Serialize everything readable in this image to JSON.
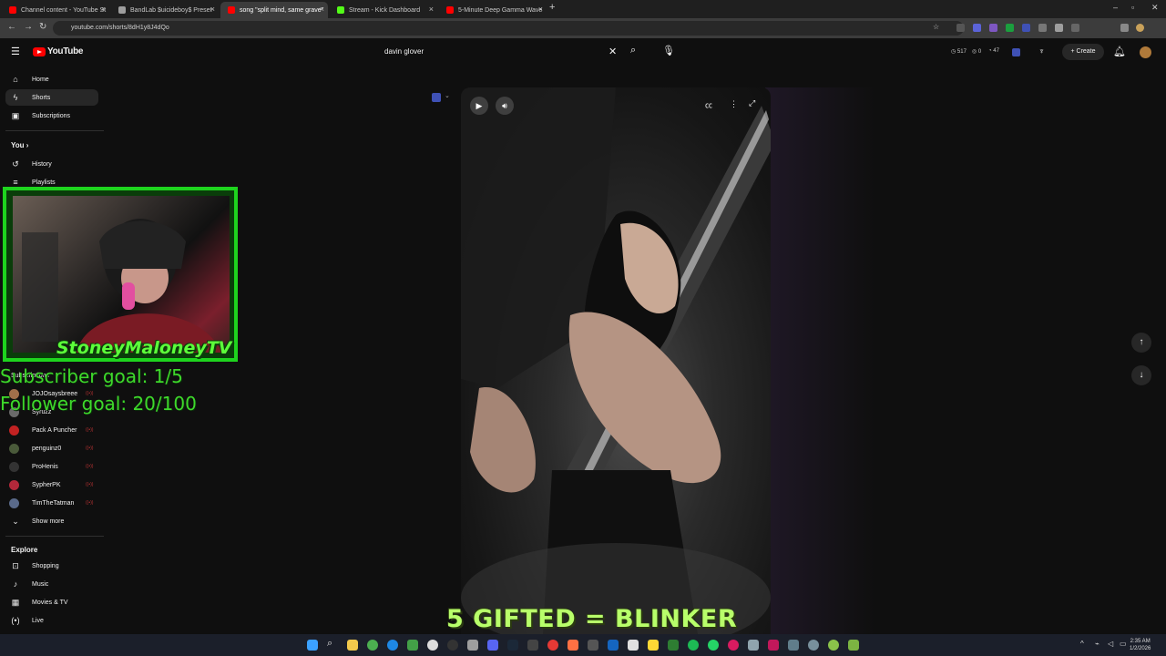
{
  "browser": {
    "tabs": [
      {
        "title": "Channel content - YouTube St",
        "color": "#ff0000"
      },
      {
        "title": "BandLab $uicideboy$ Preset",
        "color": "#9e9e9e"
      },
      {
        "title": "song \"split mind, same grave\"",
        "color": "#ff0000"
      },
      {
        "title": "Stream - Kick Dashboard",
        "color": "#53fc18"
      },
      {
        "title": "5-Minute Deep Gamma Wave",
        "color": "#ff0000"
      }
    ],
    "new_tab": "+",
    "url": "youtube.com/shorts/8dH1y8J4dQo"
  },
  "youtube": {
    "logo": "YouTube",
    "search_query": "davin glover",
    "header_stats": {
      "views": "517",
      "a": "0",
      "b": "47"
    },
    "create_label": "Create",
    "sidebar": {
      "main": [
        {
          "label": "Home",
          "icon": "home-icon"
        },
        {
          "label": "Shorts",
          "icon": "shorts-icon"
        },
        {
          "label": "Subscriptions",
          "icon": "subscriptions-icon"
        }
      ],
      "you_title": "You",
      "you_items": [
        {
          "label": "History",
          "icon": "history-icon"
        },
        {
          "label": "Playlists",
          "icon": "playlists-icon"
        }
      ],
      "subscriptions_title": "Subscriptions",
      "subscriptions": [
        {
          "name": "JOJOsaysbreee",
          "color": "#a0704a"
        },
        {
          "name": "Syruzz",
          "color": "#6a6a6a"
        },
        {
          "name": "Pack A Puncher",
          "color": "#c22222"
        },
        {
          "name": "penguinz0",
          "color": "#4a5a3a"
        },
        {
          "name": "ProHenis",
          "color": "#333333"
        },
        {
          "name": "SypherPK",
          "color": "#b3283a"
        },
        {
          "name": "TimTheTatman",
          "color": "#5a6a8a"
        }
      ],
      "show_more": "Show more",
      "explore_title": "Explore",
      "explore": [
        {
          "label": "Shopping",
          "icon": "shopping-icon"
        },
        {
          "label": "Music",
          "icon": "music-icon"
        },
        {
          "label": "Movies & TV",
          "icon": "movies-icon"
        },
        {
          "label": "Live",
          "icon": "live-icon"
        }
      ]
    }
  },
  "overlay": {
    "brand": "StoneyMaloneyTV",
    "subscriber_goal": "Subscriber goal: 1/5",
    "follower_goal": "Follower goal: 20/100",
    "gifted_banner": "5 GIFTED = BLINKER"
  },
  "taskbar": {
    "time": "2:35 AM",
    "date": "1/2/2026"
  },
  "colors": {
    "overlay_green": "#1ed41e",
    "yt_red": "#ff0000",
    "background": "#0f0f0f"
  }
}
